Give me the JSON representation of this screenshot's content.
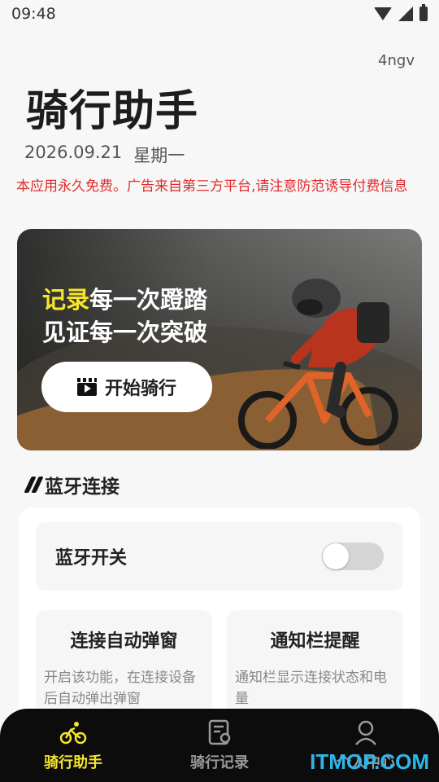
{
  "status_bar": {
    "time": "09:48"
  },
  "header": {
    "code": "4ngv",
    "title": "骑行助手",
    "date": "2026.09.21",
    "weekday": "星期一",
    "notice": "本应用永久免费。广告来自第三方平台,请注意防范诱导付费信息"
  },
  "banner": {
    "line1_highlight": "记录",
    "line1_rest": "每一次蹬踏",
    "line2": "见证每一次突破",
    "button_label": "开始骑行"
  },
  "bluetooth": {
    "section_title": "蓝牙连接",
    "switch_label": "蓝牙开关",
    "switch_on": false,
    "features": [
      {
        "title": "连接自动弹窗",
        "desc": "开启该功能，在连接设备后自动弹出弹窗"
      },
      {
        "title": "通知栏提醒",
        "desc": "通知栏显示连接状态和电量"
      }
    ]
  },
  "tabs": [
    {
      "label": "骑行助手",
      "icon": "bike-icon",
      "active": true
    },
    {
      "label": "骑行记录",
      "icon": "record-icon",
      "active": false
    },
    {
      "label": "个人中心",
      "icon": "user-icon",
      "active": false
    }
  ],
  "watermark": "ITMOP.COM",
  "colors": {
    "accent": "#f5e62a",
    "notice": "#e12b2b",
    "tabbar": "#0c0c0c"
  }
}
